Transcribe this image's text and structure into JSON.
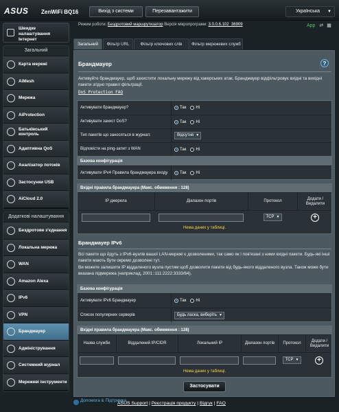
{
  "header": {
    "brand": "ASUS",
    "model": "ZenWiFi BQ16",
    "logout_label": "Вихід з системи",
    "reboot_label": "Перезавантажити",
    "language": "Українська"
  },
  "status": {
    "mode_label": "Режим роботи:",
    "mode_value": "Бездротовий маршрутизатор",
    "firmware_label": "Версія мікропрограми:",
    "firmware_value": "3.0.0.6.102_36909",
    "app_label": "App"
  },
  "sidebar": {
    "quick_setup": "Швидке налаштування Інтернет",
    "general_header": "Загальний",
    "general_items": [
      {
        "label": "Карта мережі"
      },
      {
        "label": "AiMesh"
      },
      {
        "label": "Мережа"
      },
      {
        "label": "AiProtection"
      },
      {
        "label": "Батьківський контроль"
      },
      {
        "label": "Адаптивна QoS"
      },
      {
        "label": "Аналізатор потоків"
      },
      {
        "label": "Застосунки USB"
      },
      {
        "label": "AiCloud 2.0"
      }
    ],
    "advanced_header": "Додаткові налаштування",
    "advanced_items": [
      {
        "label": "Бездротове з'єднання"
      },
      {
        "label": "Локальна мережа"
      },
      {
        "label": "WAN"
      },
      {
        "label": "Amazon Alexa"
      },
      {
        "label": "IPv6"
      },
      {
        "label": "VPN"
      },
      {
        "label": "Брандмауер"
      },
      {
        "label": "Адміністрування"
      },
      {
        "label": "Системний журнал"
      },
      {
        "label": "Мережеві інструменти"
      }
    ],
    "active": "Брандмауер"
  },
  "tabs": [
    "Загальний",
    "Фільтр URL",
    "Фільтр ключових слів",
    "Фільтр мережевих служб"
  ],
  "firewall": {
    "title": "Брандмауер",
    "help": "?",
    "description": "Активуйте брандмауер, щоб захистити локальну мережу від хакерських атак. Брандмауер відфільтровує вхідні та вихідні пакети згідно правил фільтрації.",
    "faq_link": "DoS Protection FAQ",
    "settings": [
      {
        "label": "Активувати брандмауер?",
        "type": "radio",
        "yes": "Так",
        "no": "Ні",
        "selected": "yes"
      },
      {
        "label": "Активувати захист DoS?",
        "type": "radio",
        "yes": "Так",
        "no": "Ні",
        "selected": "yes"
      },
      {
        "label": "Тип пакетів що заносяться в журнал:",
        "type": "select",
        "value": "Відсутня"
      },
      {
        "label": "Відповісти на ping-запит з WAN",
        "type": "radio",
        "yes": "Так",
        "no": "Ні",
        "selected": "yes"
      }
    ],
    "basic_config_header": "Базова конфігурація",
    "ipv4_inbound_label": "Активувати IPv4 Правила брандмауера входу",
    "ipv4_inbound": {
      "yes": "Так",
      "no": "Ні",
      "selected": "yes"
    },
    "inbound_rules_header": "Вхідні правила брандмауера (Макс. обмеження : 128)",
    "inbound_columns": [
      "IP джерела",
      "Діапазон портів",
      "Протокол",
      "Додати / Видалити"
    ],
    "inbound_protocol": "TCP",
    "no_data": "Нема даних у таблиці."
  },
  "ipv6": {
    "title": "Брандмауер IPv6",
    "description1": "Всі пакети що йдуть з IPv6-вузлів вашої LAN-мережі є дозволеними, так само як і пов'язані з ними вхідні пакети. Будь-які інші пакети мають бути окремо дозволені тут.",
    "description2": "Ви можете залишити IP віддаленого вузла пустим щоб дозволити пакети від будь-якого віддаленого вузла. Також може бути вказана підмережа (наприклад, 2001::111:2222:3333/64).",
    "basic_config_header": "Базова конфігурація",
    "enable_label": "Активувати IPv6 Брандмауер",
    "enable": {
      "yes": "Так",
      "no": "Ні",
      "selected": "yes"
    },
    "popular_label": "Список популярних серверів",
    "popular_value": "Будь ласка, виберіть",
    "inbound_rules_header": "Вхідні правила брандмауера (Макс. обмеження : 128)",
    "columns": [
      "Назва служби",
      "Віддалений IP/CIDR",
      "Локальний IP",
      "Діапазон портів",
      "Протокол",
      "Додати / Видалити"
    ],
    "protocol": "TCP",
    "no_data": "Нема даних у таблиці."
  },
  "apply_label": "Застосувати",
  "footer": {
    "help_support": "Допомога & Підтримка",
    "links": [
      "ASUS Support",
      "Реєстрація продукту",
      "Відгук",
      "FAQ"
    ]
  }
}
